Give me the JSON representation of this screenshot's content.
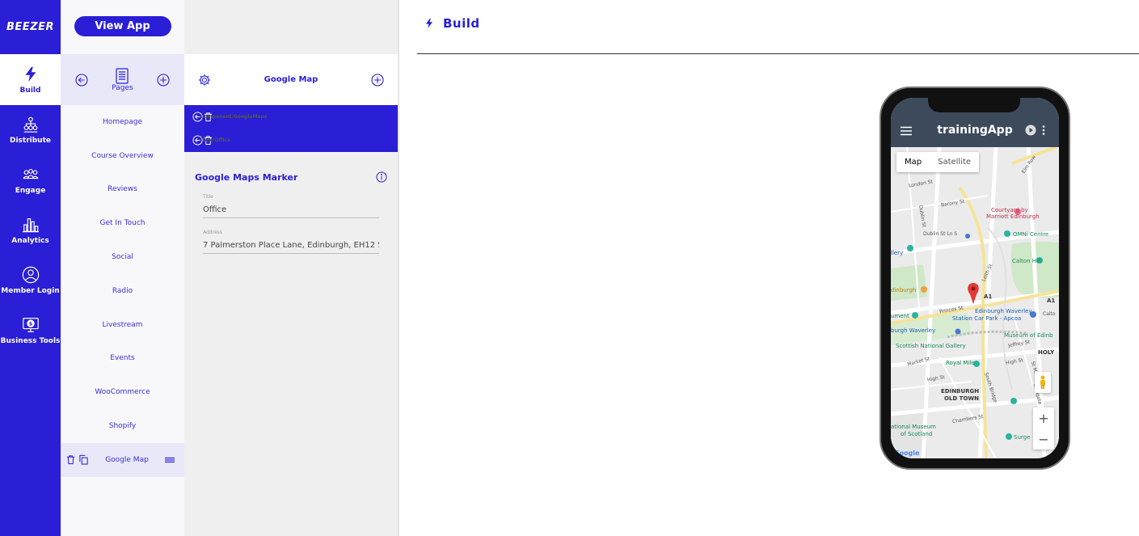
{
  "brand": {
    "logo": "BEEZER",
    "accent": "#2a1ed6"
  },
  "nav": {
    "items": [
      {
        "label": "Build",
        "icon": "lightning-icon",
        "active": true
      },
      {
        "label": "Distribute",
        "icon": "network-icon"
      },
      {
        "label": "Engage",
        "icon": "group-icon"
      },
      {
        "label": "Analytics",
        "icon": "bar-chart-icon"
      },
      {
        "label": "Member Login",
        "icon": "user-circle-icon"
      },
      {
        "label": "Business Tools",
        "icon": "monitor-dollar-icon"
      }
    ]
  },
  "pages_panel": {
    "view_app_label": "View App",
    "header_label": "Pages",
    "items": [
      "Homepage",
      "Course Overview",
      "Reviews",
      "Get In Touch",
      "Social",
      "Radio",
      "Livestream",
      "Events",
      "WooCommerce",
      "Shopify"
    ],
    "selected": "Google Map"
  },
  "component_panel": {
    "title": "Google Map",
    "breadcrumbs": [
      "Component/GoogleMaps",
      "Item/Office"
    ],
    "section_title": "Google Maps Marker",
    "fields": {
      "title_label": "Title",
      "title_value": "Office",
      "address_label": "Address",
      "address_value": "7 Palmerston Place Lane, Edinburgh, EH12 5AE"
    }
  },
  "main": {
    "title": "Build"
  },
  "preview": {
    "app_title": "trainingApp",
    "map_tabs": [
      "Map",
      "Satellite"
    ],
    "zoom_in": "+",
    "zoom_out": "−",
    "map_labels": {
      "elm_row": "Elm Row",
      "london_st": "London St",
      "barony_st": "Barony St",
      "dublin_st": "Dublin St",
      "dublin_st_ln": "Dublin St Ln S",
      "courtyard": "Courtyard by",
      "marriott": "Marriott Edinburgh",
      "omni": "OMNi Centre",
      "calton": "Calton Hill",
      "gallery": "llery",
      "leith_st": "Leith St",
      "edinburgh_poi": "dinburgh",
      "a1": "A1",
      "a1b": "A1",
      "princes_st": "Princes St",
      "waverley1": "Edinburgh Waverley",
      "waverley2": "Station Car Park - Apcoa",
      "calton_rd": "Calto",
      "monument": "ument",
      "waverley_stn": "burgh Waverley",
      "museum_edin": "Museum of Edinb",
      "scottish_gallery": "Scottish National Gallery",
      "jeffrey_st": "Jeffrey St",
      "holy": "HOLY",
      "market_st": "Market St",
      "royal_mile": "Royal Mile",
      "high_st1": "High St",
      "high_st2": "High St",
      "st_marys": "St Mary's",
      "south_bridge": "South Bridge",
      "old_town1": "EDINBURGH",
      "old_town2": "OLD TOWN",
      "cowgate": "Cowgate",
      "chambers_st": "Chambers St",
      "natmuseum1": "ational Museum",
      "natmuseum2": "of Scotland",
      "surgeons": "Surge",
      "google": "Google"
    }
  }
}
